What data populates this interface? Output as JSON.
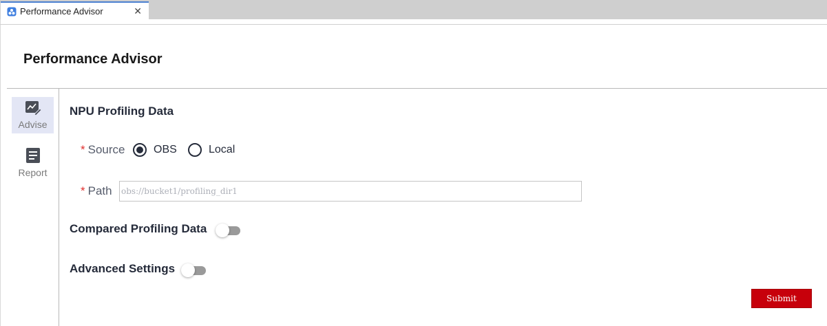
{
  "window": {
    "tab_title": "Performance Advisor",
    "close_glyph": "✕"
  },
  "header": {
    "title": "Performance Advisor"
  },
  "sidebar": {
    "items": [
      {
        "label": "Advise",
        "icon": "chart-edit-icon",
        "active": true
      },
      {
        "label": "Report",
        "icon": "document-icon",
        "active": false
      }
    ]
  },
  "form": {
    "npu_section_title": "NPU Profiling Data",
    "source": {
      "label": "Source",
      "required_mark": "*",
      "options": [
        "OBS",
        "Local"
      ],
      "selected": "OBS"
    },
    "path": {
      "label": "Path",
      "required_mark": "*",
      "value": "",
      "placeholder": "obs://bucket1/profiling_dir1"
    },
    "compared_profiling": {
      "label": "Compared Profiling Data",
      "enabled": false
    },
    "advanced_settings": {
      "label": "Advanced Settings",
      "enabled": false
    },
    "submit_label": "Submit"
  },
  "colors": {
    "accent": "#c7000b",
    "required": "#e0302e",
    "sidebar_active_bg": "#e3e6f5",
    "toggle_off": "#9a9a9a"
  }
}
